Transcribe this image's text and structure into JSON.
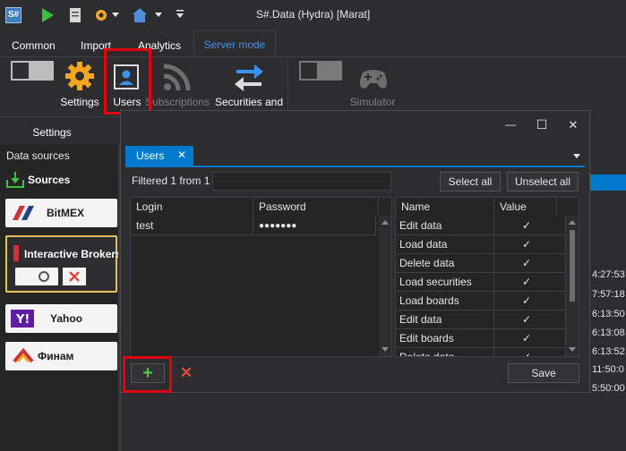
{
  "window": {
    "title": "S#.Data (Hydra) [Marat]",
    "app_logo": "S#",
    "controls": {
      "minimize": "—",
      "maximize": "☐",
      "close": "✕"
    }
  },
  "ribbon": {
    "tabs": [
      "Common",
      "Import",
      "Analytics",
      "Server mode"
    ],
    "active_tab": "Server mode",
    "buttons": {
      "settings": "Settings",
      "users": "Users",
      "subscriptions": "Subscriptions",
      "securities": "Securities and",
      "simulator": "Simulator"
    },
    "group_label": "Settings"
  },
  "left_panel": {
    "title": "Data sources",
    "sources_label": "Sources",
    "items": [
      {
        "name": "BitMEX"
      },
      {
        "name": "Interactive Brokers"
      },
      {
        "name": "Yahoo"
      },
      {
        "name": "Финам"
      }
    ]
  },
  "dialog": {
    "tab_label": "Users",
    "tab_close": "✕",
    "filter_text": "Filtered 1 from 1",
    "filter_value": "",
    "select_all": "Select all",
    "unselect_all": "Unselect all",
    "users_headers": {
      "login": "Login",
      "password": "Password"
    },
    "users": [
      {
        "login": "test",
        "password": "●●●●●●●"
      }
    ],
    "perm_headers": {
      "name": "Name",
      "value": "Value"
    },
    "permissions": [
      {
        "name": "Edit data",
        "value": "✓"
      },
      {
        "name": "Load data",
        "value": "✓"
      },
      {
        "name": "Delete data",
        "value": "✓"
      },
      {
        "name": "Load securities",
        "value": "✓"
      },
      {
        "name": "Load boards",
        "value": "✓"
      },
      {
        "name": "Edit data",
        "value": "✓"
      },
      {
        "name": "Edit boards",
        "value": "✓"
      },
      {
        "name": "Delete data",
        "value": "✓"
      }
    ],
    "add_icon": "+",
    "delete_icon": "✕",
    "save": "Save"
  },
  "right_times": [
    "4:27:53",
    "7:57:18",
    "6:13:50",
    "6:13:08",
    "6:13:52",
    "11:50:0",
    "5:50:00"
  ]
}
